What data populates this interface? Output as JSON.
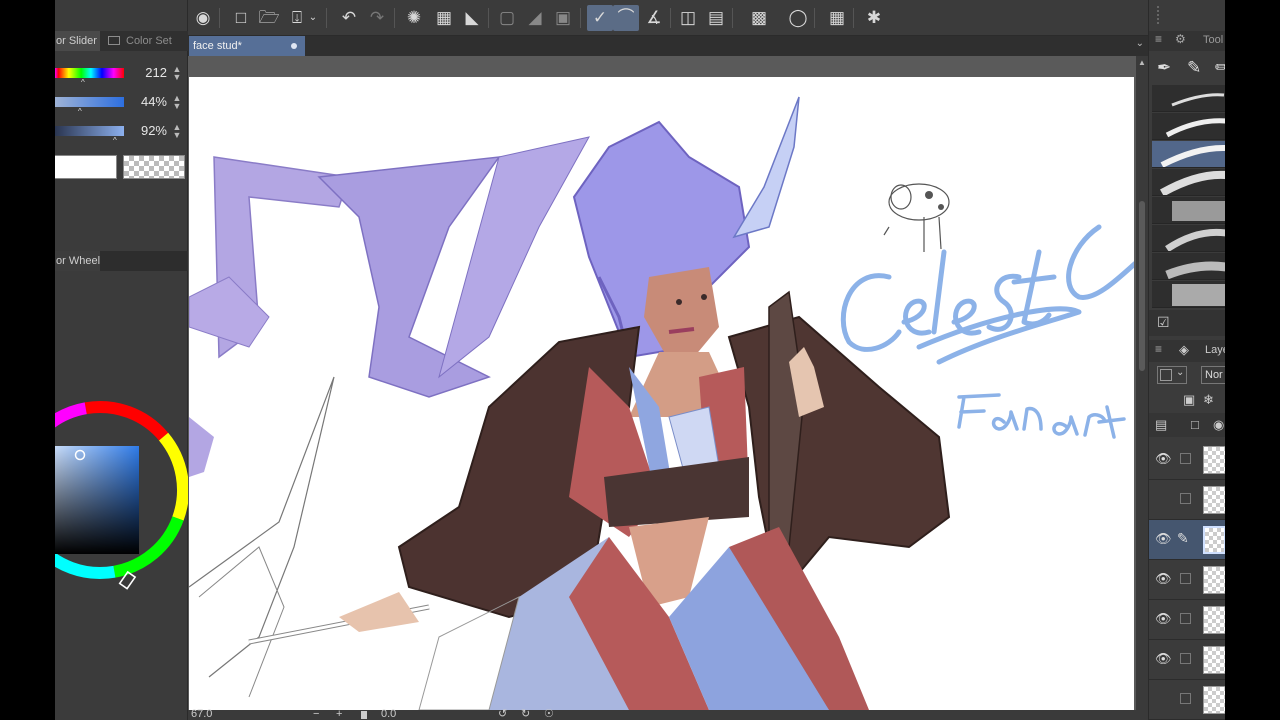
{
  "left_panel": {
    "tab_color_slider": "or Slider",
    "tab_color_set": "Color Set",
    "slider_h": "212",
    "slider_s": "44%",
    "slider_v": "92%",
    "tab_color_wheel": "or Wheel"
  },
  "toolbar": {
    "icons": [
      "clip-studio-icon",
      "new-icon",
      "open-icon",
      "save-icon",
      "menu-arrow-icon",
      "undo-icon",
      "redo-icon",
      "loading-icon",
      "clear-icon",
      "fill-icon",
      "deselect-icon",
      "invert-icon",
      "select-all-icon",
      "snap-ruler-icon",
      "snap-special-icon",
      "snap-grid-icon",
      "window-icon",
      "layer-prop-icon",
      "tone-icon",
      "lasso-icon",
      "transform-icon",
      "magic-icon"
    ]
  },
  "document": {
    "tab_title": "face stud*"
  },
  "statusbar": {
    "zoom": "67.0",
    "rotation": "0.0",
    "minus": "−",
    "plus": "+"
  },
  "right_panel": {
    "tool_tab": "Tool",
    "layer_tab": "Laye",
    "blend_mode": "Nor"
  },
  "colors": {
    "accent": "#566f97",
    "panel_bg": "#3b3b3b",
    "hue_value": "#5b7fd0"
  }
}
